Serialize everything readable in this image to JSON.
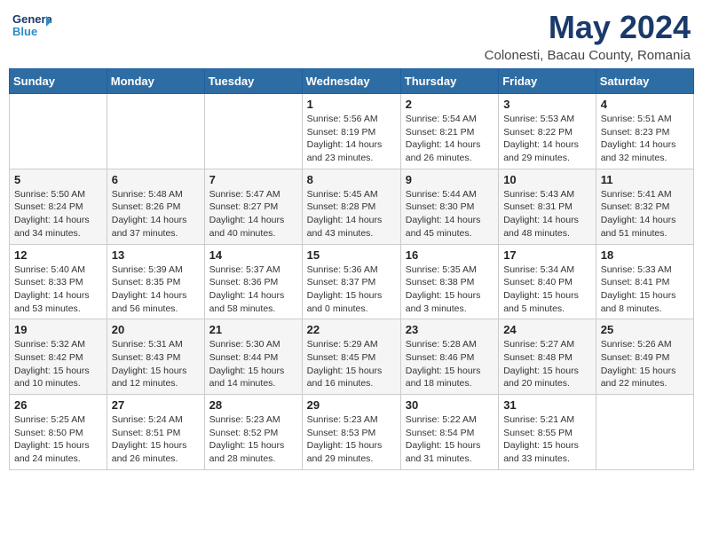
{
  "logo": {
    "general": "General",
    "blue": "Blue"
  },
  "title": "May 2024",
  "location": "Colonesti, Bacau County, Romania",
  "days_of_week": [
    "Sunday",
    "Monday",
    "Tuesday",
    "Wednesday",
    "Thursday",
    "Friday",
    "Saturday"
  ],
  "weeks": [
    [
      {
        "day": "",
        "info": ""
      },
      {
        "day": "",
        "info": ""
      },
      {
        "day": "",
        "info": ""
      },
      {
        "day": "1",
        "info": "Sunrise: 5:56 AM\nSunset: 8:19 PM\nDaylight: 14 hours\nand 23 minutes."
      },
      {
        "day": "2",
        "info": "Sunrise: 5:54 AM\nSunset: 8:21 PM\nDaylight: 14 hours\nand 26 minutes."
      },
      {
        "day": "3",
        "info": "Sunrise: 5:53 AM\nSunset: 8:22 PM\nDaylight: 14 hours\nand 29 minutes."
      },
      {
        "day": "4",
        "info": "Sunrise: 5:51 AM\nSunset: 8:23 PM\nDaylight: 14 hours\nand 32 minutes."
      }
    ],
    [
      {
        "day": "5",
        "info": "Sunrise: 5:50 AM\nSunset: 8:24 PM\nDaylight: 14 hours\nand 34 minutes."
      },
      {
        "day": "6",
        "info": "Sunrise: 5:48 AM\nSunset: 8:26 PM\nDaylight: 14 hours\nand 37 minutes."
      },
      {
        "day": "7",
        "info": "Sunrise: 5:47 AM\nSunset: 8:27 PM\nDaylight: 14 hours\nand 40 minutes."
      },
      {
        "day": "8",
        "info": "Sunrise: 5:45 AM\nSunset: 8:28 PM\nDaylight: 14 hours\nand 43 minutes."
      },
      {
        "day": "9",
        "info": "Sunrise: 5:44 AM\nSunset: 8:30 PM\nDaylight: 14 hours\nand 45 minutes."
      },
      {
        "day": "10",
        "info": "Sunrise: 5:43 AM\nSunset: 8:31 PM\nDaylight: 14 hours\nand 48 minutes."
      },
      {
        "day": "11",
        "info": "Sunrise: 5:41 AM\nSunset: 8:32 PM\nDaylight: 14 hours\nand 51 minutes."
      }
    ],
    [
      {
        "day": "12",
        "info": "Sunrise: 5:40 AM\nSunset: 8:33 PM\nDaylight: 14 hours\nand 53 minutes."
      },
      {
        "day": "13",
        "info": "Sunrise: 5:39 AM\nSunset: 8:35 PM\nDaylight: 14 hours\nand 56 minutes."
      },
      {
        "day": "14",
        "info": "Sunrise: 5:37 AM\nSunset: 8:36 PM\nDaylight: 14 hours\nand 58 minutes."
      },
      {
        "day": "15",
        "info": "Sunrise: 5:36 AM\nSunset: 8:37 PM\nDaylight: 15 hours\nand 0 minutes."
      },
      {
        "day": "16",
        "info": "Sunrise: 5:35 AM\nSunset: 8:38 PM\nDaylight: 15 hours\nand 3 minutes."
      },
      {
        "day": "17",
        "info": "Sunrise: 5:34 AM\nSunset: 8:40 PM\nDaylight: 15 hours\nand 5 minutes."
      },
      {
        "day": "18",
        "info": "Sunrise: 5:33 AM\nSunset: 8:41 PM\nDaylight: 15 hours\nand 8 minutes."
      }
    ],
    [
      {
        "day": "19",
        "info": "Sunrise: 5:32 AM\nSunset: 8:42 PM\nDaylight: 15 hours\nand 10 minutes."
      },
      {
        "day": "20",
        "info": "Sunrise: 5:31 AM\nSunset: 8:43 PM\nDaylight: 15 hours\nand 12 minutes."
      },
      {
        "day": "21",
        "info": "Sunrise: 5:30 AM\nSunset: 8:44 PM\nDaylight: 15 hours\nand 14 minutes."
      },
      {
        "day": "22",
        "info": "Sunrise: 5:29 AM\nSunset: 8:45 PM\nDaylight: 15 hours\nand 16 minutes."
      },
      {
        "day": "23",
        "info": "Sunrise: 5:28 AM\nSunset: 8:46 PM\nDaylight: 15 hours\nand 18 minutes."
      },
      {
        "day": "24",
        "info": "Sunrise: 5:27 AM\nSunset: 8:48 PM\nDaylight: 15 hours\nand 20 minutes."
      },
      {
        "day": "25",
        "info": "Sunrise: 5:26 AM\nSunset: 8:49 PM\nDaylight: 15 hours\nand 22 minutes."
      }
    ],
    [
      {
        "day": "26",
        "info": "Sunrise: 5:25 AM\nSunset: 8:50 PM\nDaylight: 15 hours\nand 24 minutes."
      },
      {
        "day": "27",
        "info": "Sunrise: 5:24 AM\nSunset: 8:51 PM\nDaylight: 15 hours\nand 26 minutes."
      },
      {
        "day": "28",
        "info": "Sunrise: 5:23 AM\nSunset: 8:52 PM\nDaylight: 15 hours\nand 28 minutes."
      },
      {
        "day": "29",
        "info": "Sunrise: 5:23 AM\nSunset: 8:53 PM\nDaylight: 15 hours\nand 29 minutes."
      },
      {
        "day": "30",
        "info": "Sunrise: 5:22 AM\nSunset: 8:54 PM\nDaylight: 15 hours\nand 31 minutes."
      },
      {
        "day": "31",
        "info": "Sunrise: 5:21 AM\nSunset: 8:55 PM\nDaylight: 15 hours\nand 33 minutes."
      },
      {
        "day": "",
        "info": ""
      }
    ]
  ]
}
